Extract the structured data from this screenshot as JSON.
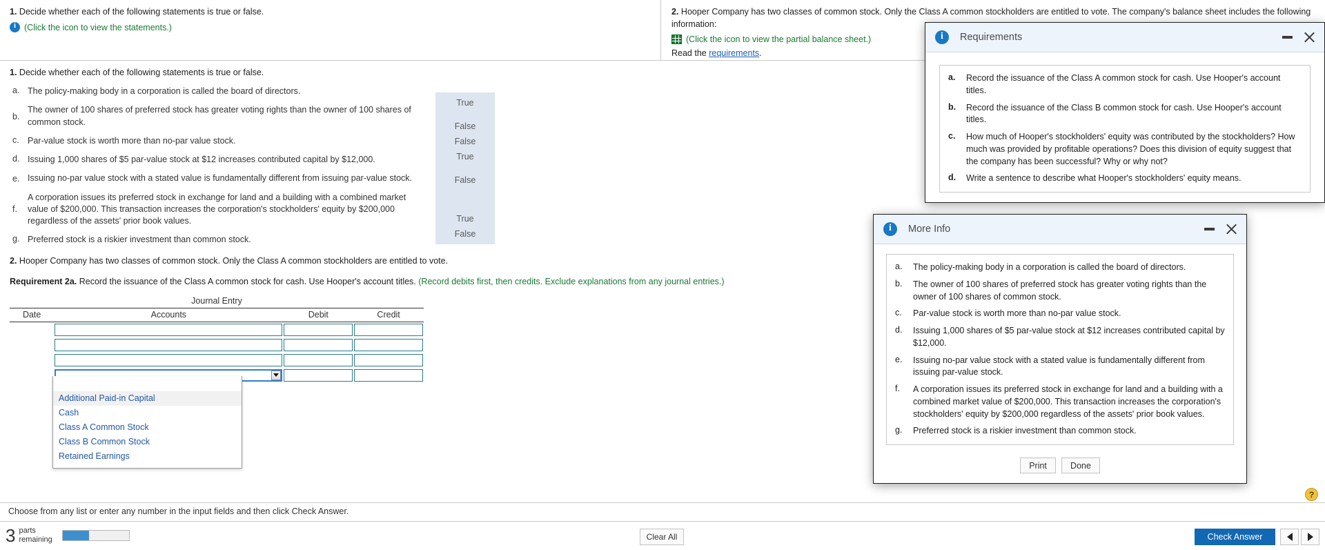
{
  "banner": {
    "left": {
      "number": "1.",
      "prompt": "Decide whether each of the following statements is true or false.",
      "icon": "info-icon",
      "link_text": "(Click the icon to view the statements.)"
    },
    "right": {
      "number": "2.",
      "prompt": "Hooper Company has two classes of common stock. Only the Class A common stockholders are entitled to vote. The company's balance sheet includes the following information:",
      "grid_icon": "grid-icon",
      "grid_link_text": "(Click the icon to view the partial balance sheet.)",
      "read_prefix": "Read the ",
      "read_link": "requirements",
      "read_suffix": "."
    }
  },
  "main": {
    "q1_number": "1.",
    "q1_prompt": "Decide whether each of the following statements is true or false.",
    "statements": [
      {
        "letter": "a.",
        "text": "The policy-making body in a corporation is called the board of directors.",
        "answer": "True"
      },
      {
        "letter": "b.",
        "text": "The owner of 100 shares of preferred stock has greater voting rights than the owner of 100 shares of common stock.",
        "answer": "False"
      },
      {
        "letter": "c.",
        "text": "Par-value stock is worth more than no-par value stock.",
        "answer": "False"
      },
      {
        "letter": "d.",
        "text": "Issuing 1,000 shares of $5 par-value stock at $12 increases contributed capital by $12,000.",
        "answer": "True"
      },
      {
        "letter": "e.",
        "text": "Issuing no-par value stock with a stated value is fundamentally different from issuing par-value stock.",
        "answer": "False"
      },
      {
        "letter": "f.",
        "text": "A corporation issues its preferred stock in exchange for land and a building with a combined market value of $200,000. This transaction increases the corporation's stockholders' equity by $200,000 regardless of the assets' prior book values.",
        "answer": "True"
      },
      {
        "letter": "g.",
        "text": "Preferred stock is a riskier investment than common stock.",
        "answer": "False"
      }
    ],
    "q2_number": "2.",
    "q2_text": "Hooper Company has two classes of common stock. Only the Class A common stockholders are entitled to vote.",
    "requirement_label": "Requirement 2a.",
    "requirement_text": "Record the issuance of the Class A common stock for cash. Use Hooper's account titles.",
    "requirement_hint": "(Record debits first, then credits. Exclude explanations from any journal entries.)",
    "journal": {
      "title": "Journal Entry",
      "columns": [
        "Date",
        "Accounts",
        "Debit",
        "Credit"
      ],
      "rows": [
        {
          "date": "",
          "account": "",
          "debit": "",
          "credit": ""
        },
        {
          "date": "",
          "account": "",
          "debit": "",
          "credit": ""
        },
        {
          "date": "",
          "account": "",
          "debit": "",
          "credit": ""
        },
        {
          "date": "",
          "account": "",
          "debit": "",
          "credit": ""
        }
      ],
      "active_row_index": 3
    },
    "dropdown": {
      "selected": "",
      "options": [
        "Additional Paid-in Capital",
        "Cash",
        "Class A Common Stock",
        "Class B Common Stock",
        "Retained Earnings"
      ],
      "highlighted_index": 0
    }
  },
  "instruction_bar": {
    "text": "Choose from any list or enter any number in the input fields and then click Check Answer.",
    "help_icon": "question-mark-icon",
    "help_label": "?"
  },
  "footer": {
    "parts_count": "3",
    "parts_label_line1": "parts",
    "parts_label_line2": "remaining",
    "progress_percent": 40,
    "clear_all_label": "Clear All",
    "check_answer_label": "Check Answer",
    "prev_icon": "triangle-left-icon",
    "next_icon": "triangle-right-icon"
  },
  "dialogs": {
    "requirements": {
      "title": "Requirements",
      "icon": "info-icon",
      "minimize_icon": "minimize-icon",
      "close_icon": "close-icon",
      "items": [
        {
          "letter": "a.",
          "text": "Record the issuance of the Class A common stock for cash. Use Hooper's account titles."
        },
        {
          "letter": "b.",
          "text": "Record the issuance of the Class B common stock for cash. Use Hooper's account titles."
        },
        {
          "letter": "c.",
          "text": "How much of Hooper's stockholders' equity was contributed by the stockholders? How much was provided by profitable operations? Does this division of equity suggest that the company has been successful? Why or why not?"
        },
        {
          "letter": "d.",
          "text": "Write a sentence to describe what Hooper's stockholders' equity means."
        }
      ]
    },
    "more_info": {
      "title": "More Info",
      "icon": "info-icon",
      "minimize_icon": "minimize-icon",
      "close_icon": "close-icon",
      "items": [
        {
          "letter": "a.",
          "text": "The policy-making body in a corporation is called the board of directors."
        },
        {
          "letter": "b.",
          "text": "The owner of 100 shares of preferred stock has greater voting rights than the owner of 100 shares of common stock."
        },
        {
          "letter": "c.",
          "text": "Par-value stock is worth more than no-par value stock."
        },
        {
          "letter": "d.",
          "text": "Issuing 1,000 shares of $5 par-value stock at $12 increases contributed capital by $12,000."
        },
        {
          "letter": "e.",
          "text": "Issuing no-par value stock with a stated value is fundamentally different from issuing par-value stock."
        },
        {
          "letter": "f.",
          "text": "A corporation issues its preferred stock in exchange for land and a building with a combined market value of $200,000. This transaction increases the corporation's stockholders' equity by $200,000 regardless of the assets' prior book values."
        },
        {
          "letter": "g.",
          "text": "Preferred stock is a riskier investment than common stock."
        }
      ],
      "print_label": "Print",
      "done_label": "Done"
    }
  },
  "colors": {
    "accent_blue": "#1268b3",
    "link_blue": "#2257a5",
    "green": "#1a7a34",
    "highlight_bg": "#dde5f0"
  }
}
